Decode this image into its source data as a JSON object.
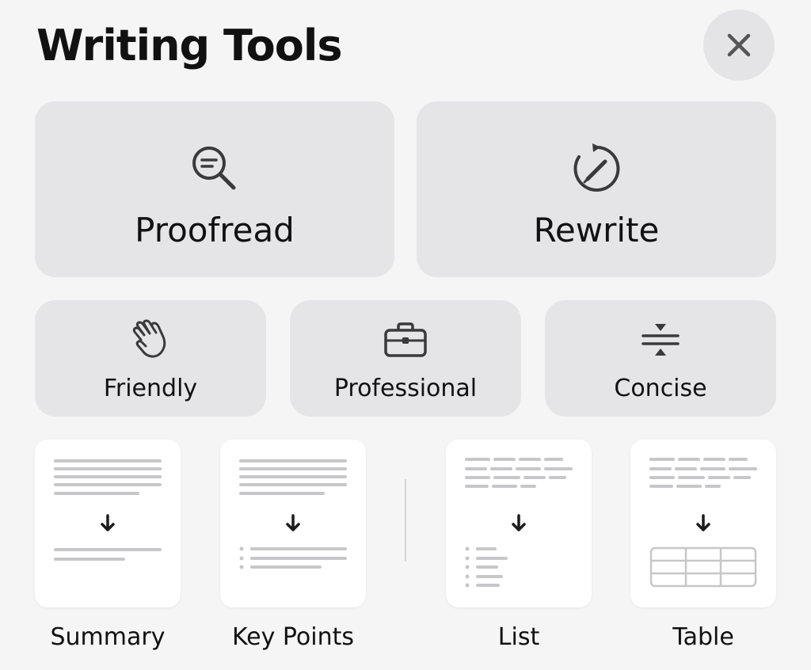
{
  "header": {
    "title": "Writing Tools"
  },
  "primary_actions": [
    {
      "label": "Proofread",
      "icon": "magnifier-lines-icon"
    },
    {
      "label": "Rewrite",
      "icon": "circular-arrow-pencil-icon"
    }
  ],
  "tone_actions": [
    {
      "label": "Friendly",
      "icon": "waving-hand-icon"
    },
    {
      "label": "Professional",
      "icon": "briefcase-icon"
    },
    {
      "label": "Concise",
      "icon": "compress-arrows-icon"
    }
  ],
  "format_actions": [
    {
      "label": "Summary",
      "icon": "summary-preview-icon"
    },
    {
      "label": "Key Points",
      "icon": "key-points-preview-icon"
    },
    {
      "label": "List",
      "icon": "list-preview-icon"
    },
    {
      "label": "Table",
      "icon": "table-preview-icon"
    }
  ],
  "colors": {
    "background": "#f5f5f6",
    "button": "#e5e5e8",
    "tile": "#ffffff",
    "icon": "#3a3a3c",
    "preview_line": "#c7c7c9"
  }
}
